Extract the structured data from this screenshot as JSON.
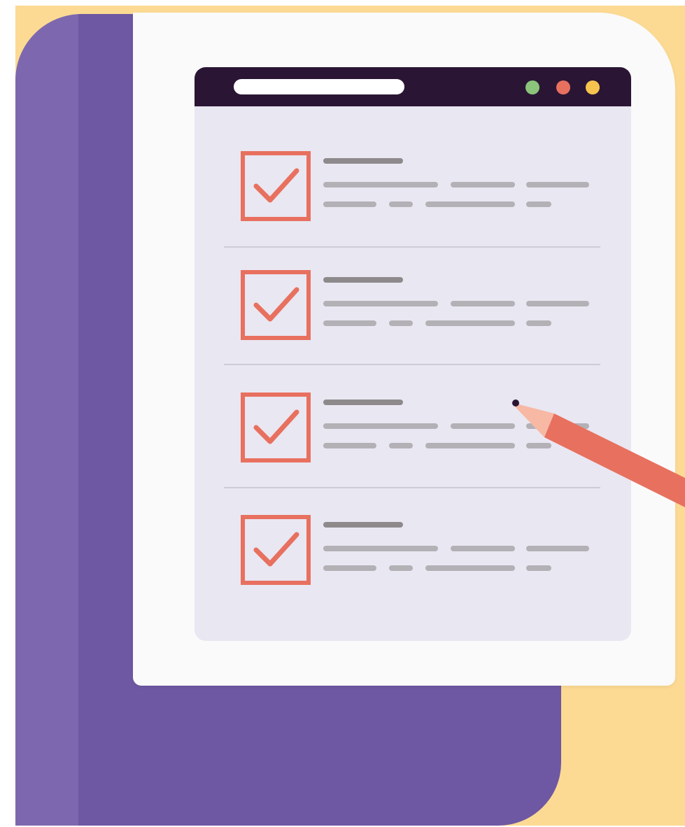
{
  "colors": {
    "background": "#FCDA93",
    "binder": "#6E58A3",
    "binder_spine": "#9A86C9",
    "sheet": "#FAFAFA",
    "window": "#E9E7F1",
    "titlebar": "#2A1634",
    "url_pill": "#FFFFFF",
    "dot_green": "#8BC47A",
    "dot_red": "#E8705F",
    "dot_yellow": "#F6C44E",
    "checkbox": "#E8705F",
    "heading_bar": "#8E8A8C",
    "text_bar": "#B3B1B6",
    "divider": "#CFCCD8",
    "pencil_body": "#E8705F",
    "pencil_tip": "#F7B8A4",
    "pencil_lead": "#2A1634"
  },
  "icons": {
    "checkbox": "checked-checkbox-icon",
    "pencil": "pencil-icon",
    "window_dots": [
      "green-dot-icon",
      "red-dot-icon",
      "yellow-dot-icon"
    ]
  },
  "checklist": {
    "items": [
      {
        "checked": true
      },
      {
        "checked": true
      },
      {
        "checked": true
      },
      {
        "checked": true
      }
    ]
  }
}
